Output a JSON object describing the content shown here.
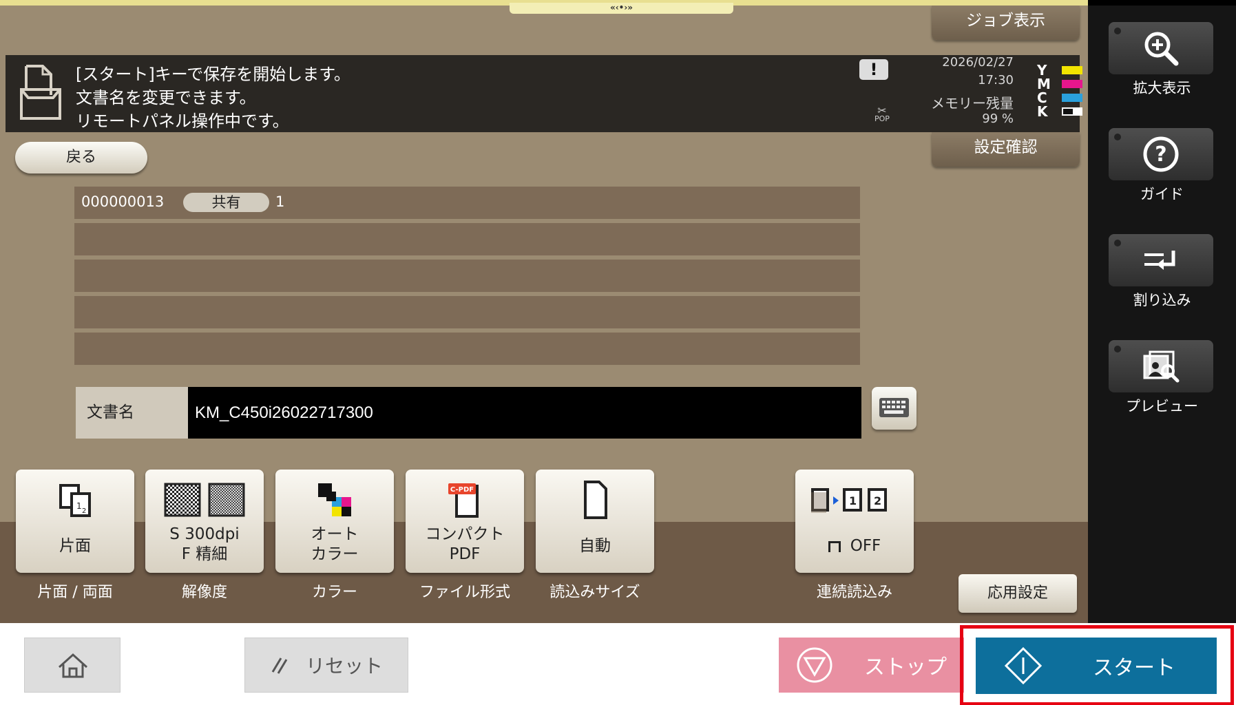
{
  "header": {
    "handle_label": "«‹•›»",
    "job_display": "ジョブ表示",
    "settings_check": "設定確認"
  },
  "messages": [
    "[スタート]キーで保存を開始します。",
    "文書名を変更できます。",
    "リモートパネル操作中です。"
  ],
  "status": {
    "date": "2026/02/27",
    "time": "17:30",
    "memory_label": "メモリー残量",
    "memory_value": "99 %",
    "warn_symbol": "!",
    "pop_label": "POP",
    "toner": [
      {
        "letter": "Y",
        "color": "#f2e400"
      },
      {
        "letter": "M",
        "color": "#e6168d"
      },
      {
        "letter": "C",
        "color": "#2aa0dc"
      },
      {
        "letter": "K",
        "color": "#111111"
      }
    ]
  },
  "back_label": "戻る",
  "box": {
    "id": "000000013",
    "badge": "共有",
    "count": "1"
  },
  "document": {
    "label": "文書名",
    "value": "KM_C450i26022717300"
  },
  "functions": [
    {
      "name": "simplex-duplex",
      "label": "片面",
      "caption": "片面 / 両面"
    },
    {
      "name": "resolution",
      "label_line1": "S 300dpi",
      "label_line2": "F 精細",
      "caption": "解像度"
    },
    {
      "name": "color",
      "label_line1": "オート",
      "label_line2": "カラー",
      "caption": "カラー"
    },
    {
      "name": "file-format",
      "label_line1": "コンパクト",
      "label_line2": "PDF",
      "caption": "ファイル形式",
      "icon_text": "C-PDF"
    },
    {
      "name": "scan-size",
      "label": "自動",
      "caption": "読込みサイズ"
    },
    {
      "name": "continuous-scan",
      "label": "OFF",
      "caption": "連続読込み"
    }
  ],
  "advanced_label": "応用設定",
  "sidebar": [
    {
      "name": "zoom",
      "label": "拡大表示"
    },
    {
      "name": "guide",
      "label": "ガイド"
    },
    {
      "name": "interrupt",
      "label": "割り込み"
    },
    {
      "name": "preview",
      "label": "プレビュー"
    }
  ],
  "bottom": {
    "reset_label": "リセット",
    "stop_label": "ストップ",
    "start_label": "スタート"
  }
}
